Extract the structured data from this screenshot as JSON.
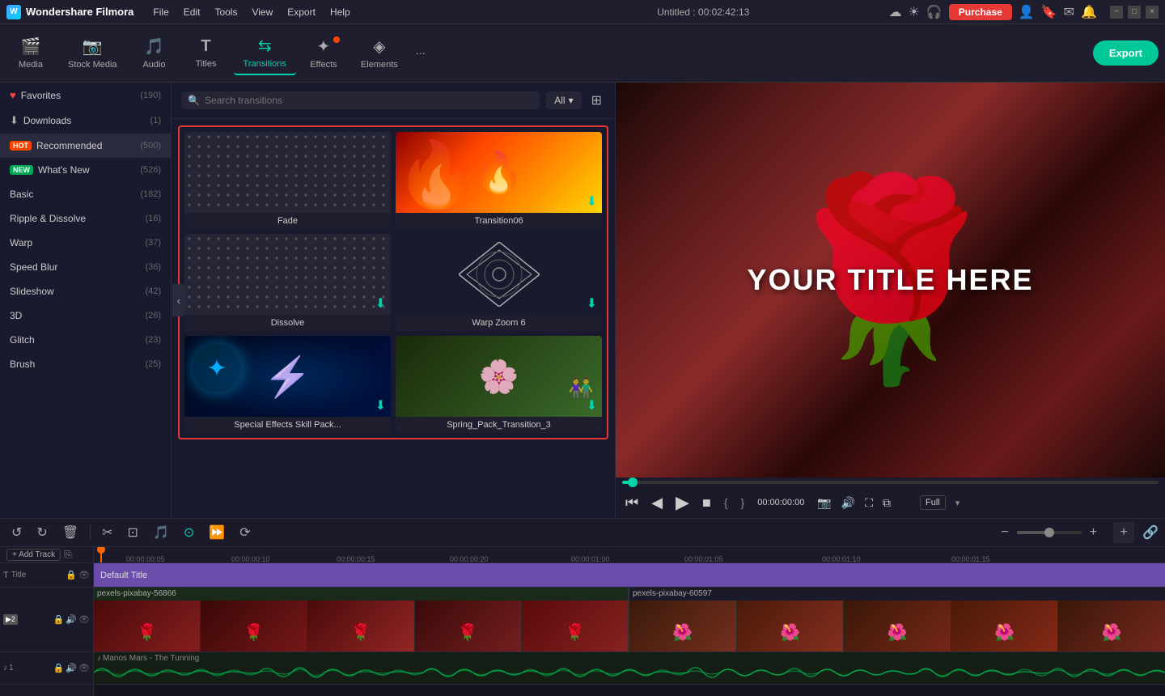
{
  "app": {
    "name": "Wondershare Filmora",
    "title": "Untitled : 00:02:42:13"
  },
  "menu": {
    "items": [
      "File",
      "Edit",
      "Tools",
      "View",
      "Export",
      "Help"
    ]
  },
  "topbar": {
    "purchase_label": "Purchase",
    "window_controls": [
      "−",
      "□",
      "×"
    ]
  },
  "toolbar": {
    "items": [
      {
        "id": "media",
        "label": "Media",
        "icon": "🎬"
      },
      {
        "id": "stock-media",
        "label": "Stock Media",
        "icon": "📷"
      },
      {
        "id": "audio",
        "label": "Audio",
        "icon": "🎵"
      },
      {
        "id": "titles",
        "label": "Titles",
        "icon": "T"
      },
      {
        "id": "transitions",
        "label": "Transitions",
        "icon": "⇆",
        "active": true
      },
      {
        "id": "effects",
        "label": "Effects",
        "icon": "✦"
      },
      {
        "id": "elements",
        "label": "Elements",
        "icon": "◈"
      }
    ],
    "export_label": "Export"
  },
  "left_panel": {
    "items": [
      {
        "id": "favorites",
        "label": "Favorites",
        "count": "(190)",
        "icon": "heart"
      },
      {
        "id": "downloads",
        "label": "Downloads",
        "count": "(1)",
        "icon": "download"
      },
      {
        "id": "recommended",
        "label": "Recommended",
        "count": "(500)",
        "badge": "HOT"
      },
      {
        "id": "whats-new",
        "label": "What's New",
        "count": "(526)",
        "badge": "NEW"
      },
      {
        "id": "basic",
        "label": "Basic",
        "count": "(182)"
      },
      {
        "id": "ripple-dissolve",
        "label": "Ripple & Dissolve",
        "count": "(16)"
      },
      {
        "id": "warp",
        "label": "Warp",
        "count": "(37)"
      },
      {
        "id": "speed-blur",
        "label": "Speed Blur",
        "count": "(36)"
      },
      {
        "id": "slideshow",
        "label": "Slideshow",
        "count": "(42)"
      },
      {
        "id": "3d",
        "label": "3D",
        "count": "(26)"
      },
      {
        "id": "glitch",
        "label": "Glitch",
        "count": "(23)"
      },
      {
        "id": "brush",
        "label": "Brush",
        "count": "(25)"
      }
    ]
  },
  "transitions": {
    "search_placeholder": "Search transitions",
    "filter_label": "All",
    "items": [
      {
        "id": "fade",
        "name": "Fade",
        "type": "fade"
      },
      {
        "id": "transition06",
        "name": "Transition06",
        "type": "fire"
      },
      {
        "id": "dissolve",
        "name": "Dissolve",
        "type": "dissolve"
      },
      {
        "id": "warp-zoom-6",
        "name": "Warp Zoom 6",
        "type": "warp"
      },
      {
        "id": "special-effects",
        "name": "Special Effects Skill Pack...",
        "type": "electric"
      },
      {
        "id": "spring-pack",
        "name": "Spring_Pack_Transition_3",
        "type": "spring"
      }
    ]
  },
  "preview": {
    "title_text": "YOUR TITLE HERE",
    "time_current": "00:00:00:00",
    "time_bracket_left": "{",
    "time_bracket_right": "}",
    "quality": "Full",
    "progress_percent": 2
  },
  "timeline": {
    "current_time": "00:00",
    "marks": [
      "00:00:00:05",
      "00:00:00:10",
      "00:00:00:15",
      "00:00:00:20",
      "00:00:01:00",
      "00:00:01:05",
      "00:00:01:10",
      "00:00:01:15"
    ],
    "tracks": [
      {
        "id": "title-track",
        "label": "Default Title",
        "type": "title"
      },
      {
        "id": "video1",
        "label": "pexels-pixabay-56866",
        "type": "video"
      },
      {
        "id": "video2",
        "label": "pexels-pixabay-60597",
        "type": "video"
      },
      {
        "id": "audio",
        "label": "Manos Mars - The Tunning",
        "type": "audio"
      }
    ]
  },
  "icons": {
    "search": "🔍",
    "heart": "♥",
    "download": "⬇",
    "play": "▶",
    "pause": "⏸",
    "stop": "■",
    "rewind": "⏮",
    "forward": "⏭",
    "undo": "↺",
    "redo": "↻",
    "delete": "🗑",
    "cut": "✂",
    "adjust": "⚙",
    "audio_ctrl": "♪",
    "lock": "🔒",
    "eye": "👁",
    "mic": "🎤",
    "zoom_in": "+",
    "zoom_out": "−",
    "grid": "⊞",
    "camera": "📷",
    "add_track": "＋"
  },
  "colors": {
    "accent": "#00d4aa",
    "purchase_red": "#e53935",
    "active_tab": "#00d4aa",
    "bg_dark": "#1a1a2e",
    "bg_mid": "#1e1e2e",
    "selection_border": "#e53935"
  }
}
